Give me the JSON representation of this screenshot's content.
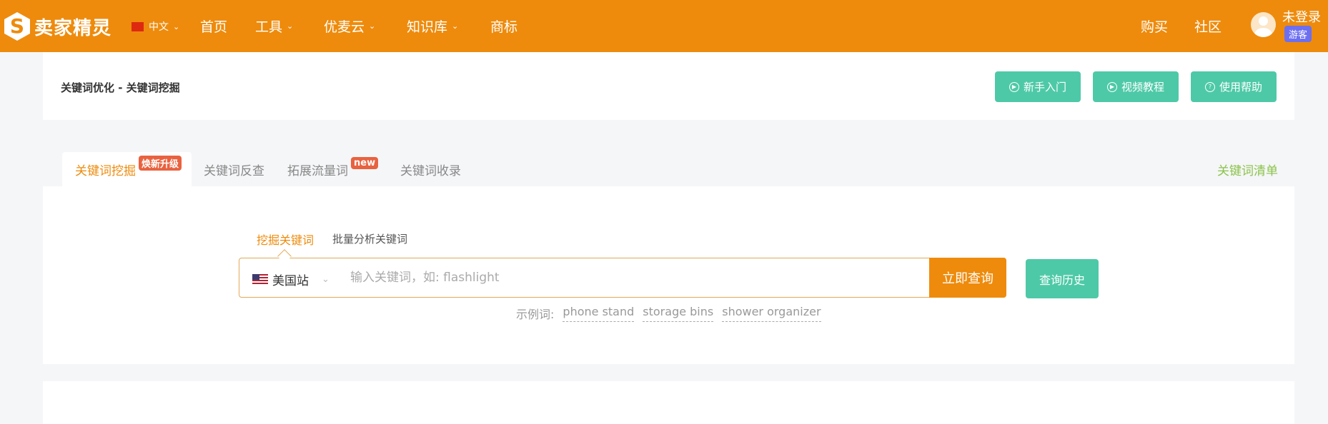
{
  "header": {
    "logo_text": "卖家精灵",
    "logo_mark": "S",
    "language": "中文",
    "nav": [
      {
        "label": "首页",
        "dropdown": false
      },
      {
        "label": "工具",
        "dropdown": true
      },
      {
        "label": "优麦云",
        "dropdown": true
      },
      {
        "label": "知识库",
        "dropdown": true
      },
      {
        "label": "商标",
        "dropdown": false
      }
    ],
    "buy": "购买",
    "community": "社区",
    "user": "未登录",
    "guest_badge": "游客"
  },
  "breadcrumb": "关键词优化 - 关键词挖掘",
  "top_buttons": [
    {
      "label": "新手入门",
      "icon": "play-icon"
    },
    {
      "label": "视频教程",
      "icon": "play-icon"
    },
    {
      "label": "使用帮助",
      "icon": "help-icon"
    }
  ],
  "tabs": [
    {
      "label": "关键词挖掘",
      "badge": "焕新升级",
      "active": true
    },
    {
      "label": "关键词反查"
    },
    {
      "label": "拓展流量词",
      "badge": "new"
    },
    {
      "label": "关键词收录"
    }
  ],
  "keyword_list_link": "关键词清单",
  "search": {
    "modes": [
      "挖掘关键词",
      "批量分析关键词"
    ],
    "site": "美国站",
    "placeholder": "输入关键词，如: flashlight",
    "value": "",
    "submit": "立即查询",
    "history": "查询历史",
    "example_label": "示例词:",
    "examples": [
      "phone stand",
      "storage bins",
      "shower organizer"
    ]
  },
  "colors": {
    "brand": "#ee8b0c",
    "accent_green": "#4ec9a7",
    "guest": "#6c6ff0",
    "badge": "#e9623f"
  }
}
